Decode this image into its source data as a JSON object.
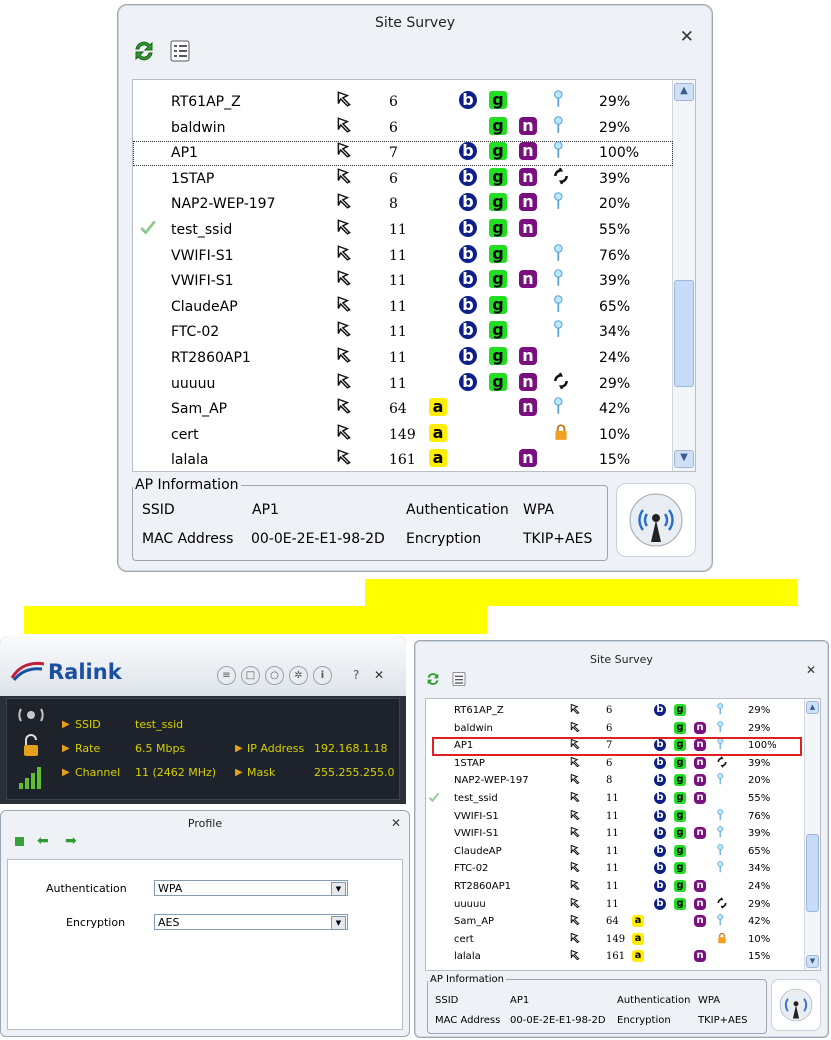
{
  "big": {
    "title": "Site Survey",
    "close": "✕",
    "rows": [
      {
        "ssid": "RT61AP_Z",
        "ch": "6",
        "b": true,
        "g": true,
        "n": false,
        "a": false,
        "sec": "wps",
        "sig": "29%",
        "sel": false,
        "conn": false
      },
      {
        "ssid": "baldwin",
        "ch": "6",
        "b": false,
        "g": true,
        "n": true,
        "a": false,
        "sec": "wps",
        "sig": "29%",
        "sel": false,
        "conn": false
      },
      {
        "ssid": "AP1",
        "ch": "7",
        "b": true,
        "g": true,
        "n": true,
        "a": false,
        "sec": "wps",
        "sig": "100%",
        "sel": true,
        "conn": false
      },
      {
        "ssid": "1STAP",
        "ch": "6",
        "b": true,
        "g": true,
        "n": true,
        "a": false,
        "sec": "adhoc",
        "sig": "39%",
        "sel": false,
        "conn": false
      },
      {
        "ssid": "NAP2-WEP-197",
        "ch": "8",
        "b": true,
        "g": true,
        "n": true,
        "a": false,
        "sec": "wps",
        "sig": "20%",
        "sel": false,
        "conn": false
      },
      {
        "ssid": "test_ssid",
        "ch": "11",
        "b": true,
        "g": true,
        "n": true,
        "a": false,
        "sec": "",
        "sig": "55%",
        "sel": false,
        "conn": true
      },
      {
        "ssid": "VWIFI-S1",
        "ch": "11",
        "b": true,
        "g": true,
        "n": false,
        "a": false,
        "sec": "wps",
        "sig": "76%",
        "sel": false,
        "conn": false
      },
      {
        "ssid": "VWIFI-S1",
        "ch": "11",
        "b": true,
        "g": true,
        "n": true,
        "a": false,
        "sec": "wps",
        "sig": "39%",
        "sel": false,
        "conn": false
      },
      {
        "ssid": "ClaudeAP",
        "ch": "11",
        "b": true,
        "g": true,
        "n": false,
        "a": false,
        "sec": "wps",
        "sig": "65%",
        "sel": false,
        "conn": false
      },
      {
        "ssid": "FTC-02",
        "ch": "11",
        "b": true,
        "g": true,
        "n": false,
        "a": false,
        "sec": "wps",
        "sig": "34%",
        "sel": false,
        "conn": false
      },
      {
        "ssid": "RT2860AP1",
        "ch": "11",
        "b": true,
        "g": true,
        "n": true,
        "a": false,
        "sec": "",
        "sig": "24%",
        "sel": false,
        "conn": false
      },
      {
        "ssid": "uuuuu",
        "ch": "11",
        "b": true,
        "g": true,
        "n": true,
        "a": false,
        "sec": "adhoc",
        "sig": "29%",
        "sel": false,
        "conn": false
      },
      {
        "ssid": "Sam_AP",
        "ch": "64",
        "b": false,
        "g": false,
        "n": true,
        "a": true,
        "sec": "wps",
        "sig": "42%",
        "sel": false,
        "conn": false
      },
      {
        "ssid": "cert",
        "ch": "149",
        "b": false,
        "g": false,
        "n": false,
        "a": true,
        "sec": "lock",
        "sig": "10%",
        "sel": false,
        "conn": false
      },
      {
        "ssid": "lalala",
        "ch": "161",
        "b": false,
        "g": false,
        "n": true,
        "a": true,
        "sec": "",
        "sig": "15%",
        "sel": false,
        "conn": false
      }
    ],
    "info": {
      "legend": "AP Information",
      "ssid_label": "SSID",
      "ssid_value": "AP1",
      "auth_label": "Authentication",
      "auth_value": "WPA",
      "mac_label": "MAC Address",
      "mac_value": "00-0E-2E-E1-98-2D",
      "enc_label": "Encryption",
      "enc_value": "TKIP+AES"
    }
  },
  "ralink": {
    "brand": "Ralink",
    "help": "?",
    "close": "✕",
    "ssid_label": "SSID",
    "ssid_value": "test_ssid",
    "rate_label": "Rate",
    "rate_value": "6.5 Mbps",
    "channel_label": "Channel",
    "channel_value": "11 (2462 MHz)",
    "ip_label": "IP Address",
    "ip_value": "192.168.1.18",
    "mask_label": "Mask",
    "mask_value": "255.255.255.0"
  },
  "profile": {
    "title": "Profile",
    "close": "✕",
    "auth_label": "Authentication",
    "auth_value": "WPA",
    "enc_label": "Encryption",
    "enc_value": "AES"
  },
  "colors": {
    "highlight": "#ffff00",
    "selection_box": "#e02020"
  }
}
